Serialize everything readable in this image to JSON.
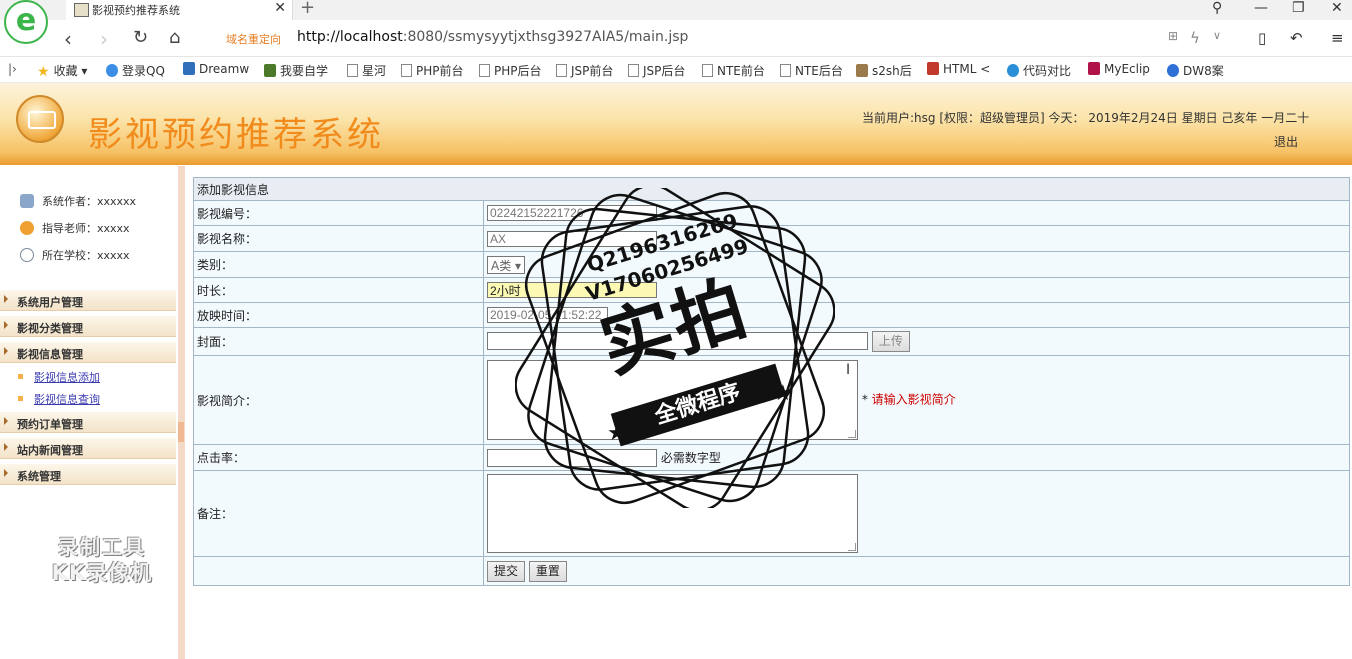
{
  "browser": {
    "tab_title": "影视预约推荐系统",
    "tab_close": "✕",
    "new_tab": "+",
    "redirect_label": "域名重定向",
    "url_host": "http://localhost",
    "url_rest": ":8080/ssmysyytjxthsg3927AIA5/main.jsp",
    "bookmarks": [
      "收藏",
      "登录QQ",
      "Dreamw",
      "我要自学",
      "星河",
      "PHP前台",
      "PHP后台",
      "JSP前台",
      "JSP后台",
      "NTE前台",
      "NTE后台",
      "s2sh后",
      "HTML <",
      "代码对比",
      "MyEclip",
      "DW8案"
    ]
  },
  "header": {
    "title": "影视预约推荐系统",
    "user_info": "当前用户:hsg [权限：超级管理员] 今天： 2019年2月24日 星期日 己亥年 一月二十",
    "logout": "退出"
  },
  "sidebar": {
    "info": [
      "系统作者：xxxxxx",
      "指导老师：xxxxx",
      "所在学校：xxxxx"
    ],
    "menus": [
      {
        "label": "系统用户管理"
      },
      {
        "label": "影视分类管理"
      },
      {
        "label": "影视信息管理",
        "subs": [
          "影视信息添加",
          "影视信息查询"
        ]
      },
      {
        "label": "预约订单管理"
      },
      {
        "label": "站内新闻管理"
      },
      {
        "label": "系统管理"
      }
    ],
    "recorder": [
      "录制工具",
      "KK录像机"
    ]
  },
  "form": {
    "caption": "添加影视信息",
    "fields": {
      "id_label": "影视编号：",
      "id_value": "02242152221726",
      "name_label": "影视名称：",
      "name_value": "AX",
      "name_req": "*",
      "category_label": "类别：",
      "category_value": "A类",
      "duration_label": "时长：",
      "duration_value": "2小时",
      "showtime_label": "放映时间：",
      "showtime_value": "2019-02-05 21:52:22",
      "cover_label": "封面：",
      "cover_value": "",
      "upload_button": "上传",
      "intro_label": "影视简介：",
      "intro_req": "*",
      "intro_hint": "请输入影视简介",
      "clickrate_label": "点击率：",
      "clickrate_value": "",
      "clickrate_hint": "必需数字型",
      "remark_label": "备注："
    },
    "submit": "提交",
    "reset": "重置"
  },
  "watermark": {
    "qq": "Q2196316269",
    "vx": "V17060256499",
    "big": "实拍",
    "banner": "全微程序"
  }
}
